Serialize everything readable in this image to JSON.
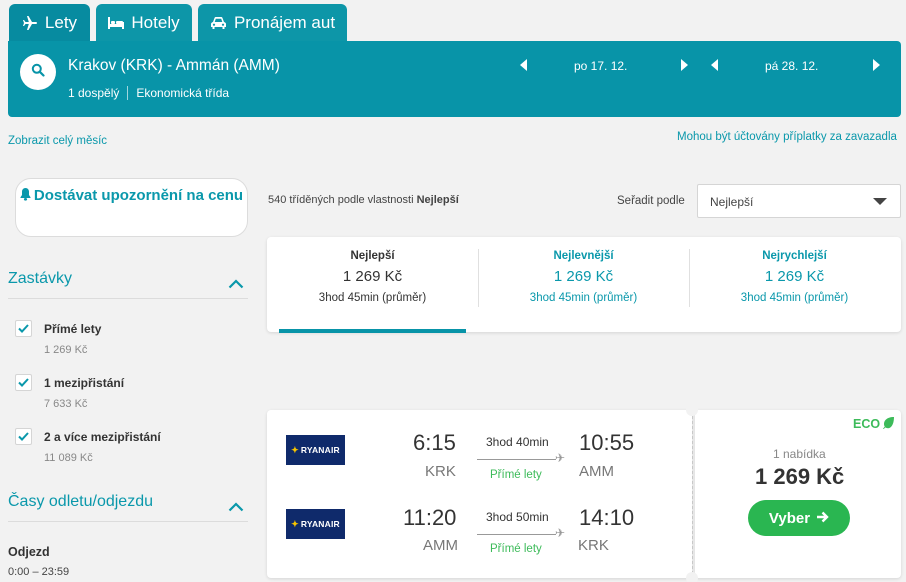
{
  "tabs": [
    {
      "label": "Lety",
      "icon": "plane-icon"
    },
    {
      "label": "Hotely",
      "icon": "bed-icon"
    },
    {
      "label": "Pronájem aut",
      "icon": "car-icon"
    }
  ],
  "search": {
    "route": "Krakov (KRK) - Ammán (AMM)",
    "passengers": "1 dospělý",
    "cabin": "Ekonomická třída",
    "depart_date": "po 17. 12.",
    "return_date": "pá 28. 12."
  },
  "links": {
    "whole_month": "Zobrazit celý měsíc",
    "baggage_fees": "Mohou být účtovány příplatky za zavazadla"
  },
  "sidebar": {
    "alert_button": "Dostávat upozornění na cenu",
    "stops_title": "Zastávky",
    "stops": [
      {
        "label": "Přímé lety",
        "price": "1 269 Kč",
        "checked": true
      },
      {
        "label": "1 mezipřistání",
        "price": "7 633 Kč",
        "checked": true
      },
      {
        "label": "2 a více mezipřistání",
        "price": "11 089 Kč",
        "checked": true
      }
    ],
    "times_title": "Časy odletu/odjezdu",
    "departure_label": "Odjezd",
    "departure_range": "0:00 – 23:59"
  },
  "results": {
    "count_text": "540 tříděných podle vlastnosti",
    "sort_key": "Nejlepší",
    "sort_label": "Seřadit podle",
    "sort_value": "Nejlepší"
  },
  "sort_tabs": [
    {
      "title": "Nejlepší",
      "price": "1 269 Kč",
      "duration": "3hod 45min (průměr)",
      "active": true
    },
    {
      "title": "Nejlevnější",
      "price": "1 269 Kč",
      "duration": "3hod 45min (průměr)",
      "active": false
    },
    {
      "title": "Nejrychlejší",
      "price": "1 269 Kč",
      "duration": "3hod 45min (průměr)",
      "active": false
    }
  ],
  "flight_card": {
    "airline": "RYANAIR",
    "legs": [
      {
        "dep_time": "6:15",
        "dep_code": "KRK",
        "duration": "3hod 40min",
        "stops": "Přímé lety",
        "arr_time": "10:55",
        "arr_code": "AMM"
      },
      {
        "dep_time": "11:20",
        "dep_code": "AMM",
        "duration": "3hod 50min",
        "stops": "Přímé lety",
        "arr_time": "14:10",
        "arr_code": "KRK"
      }
    ],
    "eco_badge": "ECO",
    "offers": "1 nabídka",
    "price": "1 269 Kč",
    "select_button": "Vyber"
  },
  "colors": {
    "brand": "#0894a8",
    "accent_text": "#0a98ab",
    "green": "#2ab651"
  }
}
